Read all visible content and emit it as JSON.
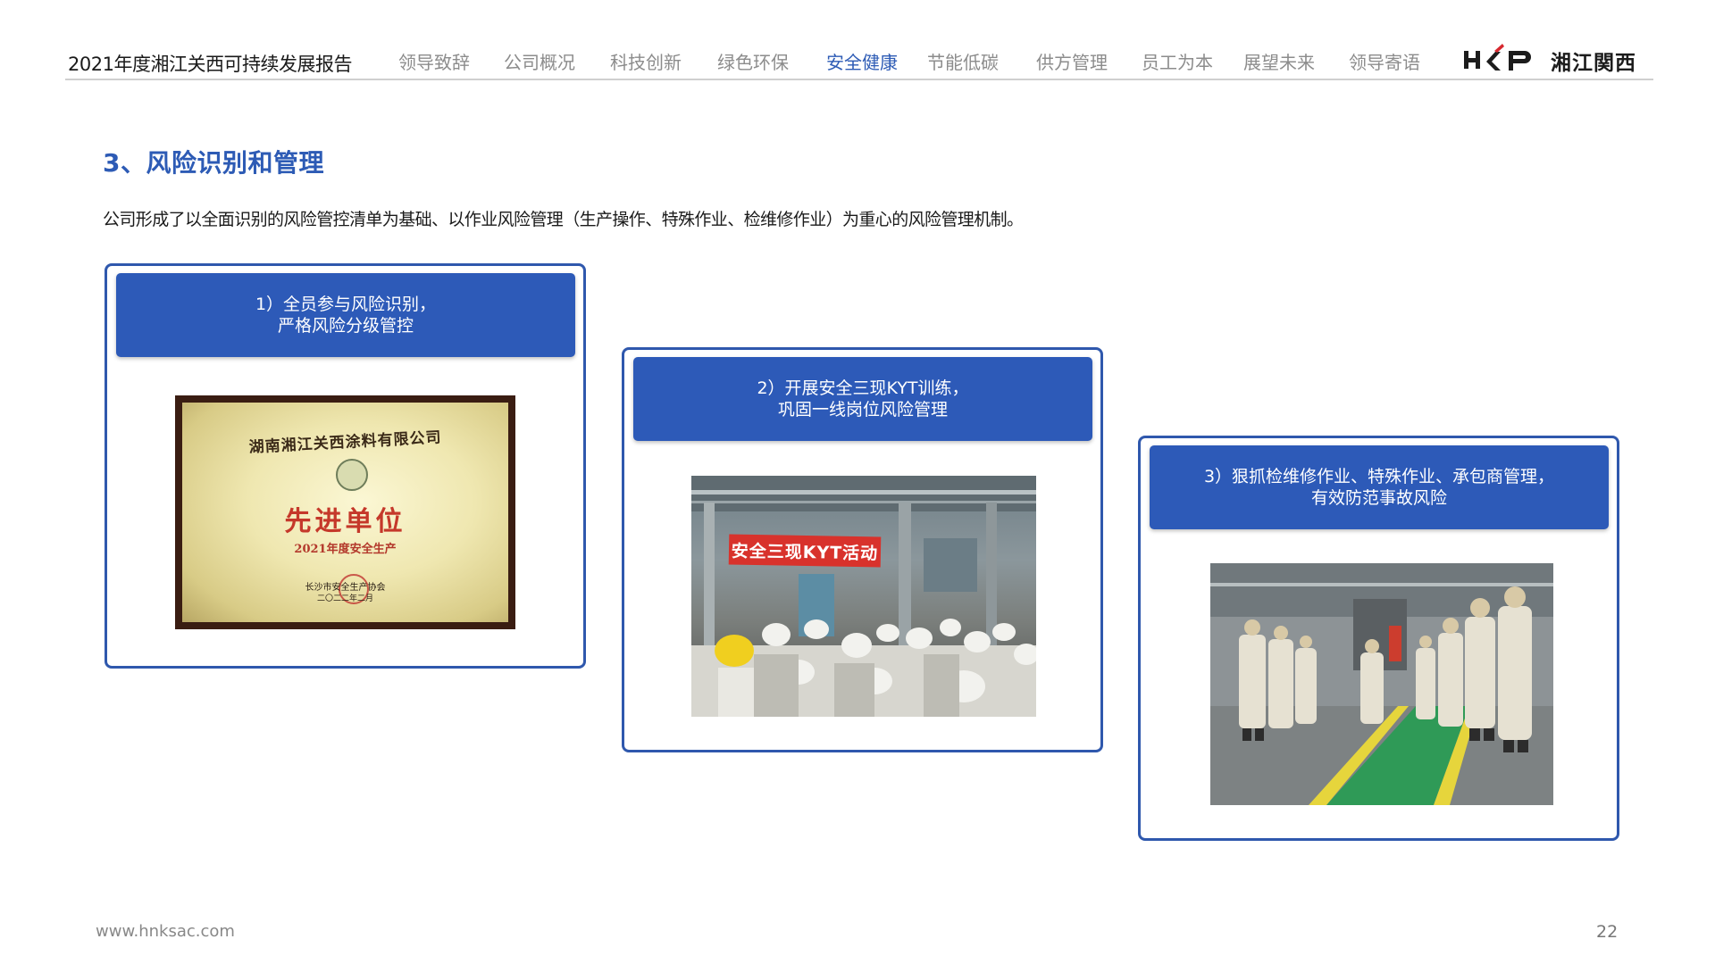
{
  "header": {
    "report_title": "2021年度湘江关西可持续发展报告",
    "nav": [
      {
        "label": "领导致辞"
      },
      {
        "label": "公司概况"
      },
      {
        "label": "科技创新"
      },
      {
        "label": "绿色环保"
      },
      {
        "label": "安全健康",
        "active": true
      },
      {
        "label": "节能低碳"
      },
      {
        "label": "供方管理"
      },
      {
        "label": "员工为本"
      },
      {
        "label": "展望未来"
      },
      {
        "label": "领导寄语"
      }
    ],
    "logo_mark": "HKP",
    "logo_text": "湘江関西"
  },
  "section": {
    "title": "3、风险识别和管理",
    "intro": "公司形成了以全面识别的风险管控清单为基础、以作业风险管理（生产操作、特殊作业、检维修作业）为重心的风险管理机制。"
  },
  "cards": [
    {
      "line1": "1）全员参与风险识别，",
      "line2": "严格风险分级管控",
      "photo": {
        "org": "湖南湘江关西涂料有限公司",
        "main": "先进单位",
        "sub": "2021年度安全生产",
        "issuer": "长沙市安全生产协会",
        "date": "二〇二二年二月"
      }
    },
    {
      "line1": "2）开展安全三现KYT训练，",
      "line2": "巩固一线岗位风险管理",
      "photo": {
        "banner": "安全三现KYT活动"
      }
    },
    {
      "line1": "3）狠抓检维修作业、特殊作业、承包商管理，",
      "line2": "有效防范事故风险"
    }
  ],
  "footer": {
    "url": "www.hnksac.com",
    "page": "22"
  },
  "colors": {
    "accent": "#2d5ab8",
    "card_border": "#2f58ad",
    "nav_active": "#2d5bb5",
    "nav_inactive": "#8c8c8c"
  }
}
